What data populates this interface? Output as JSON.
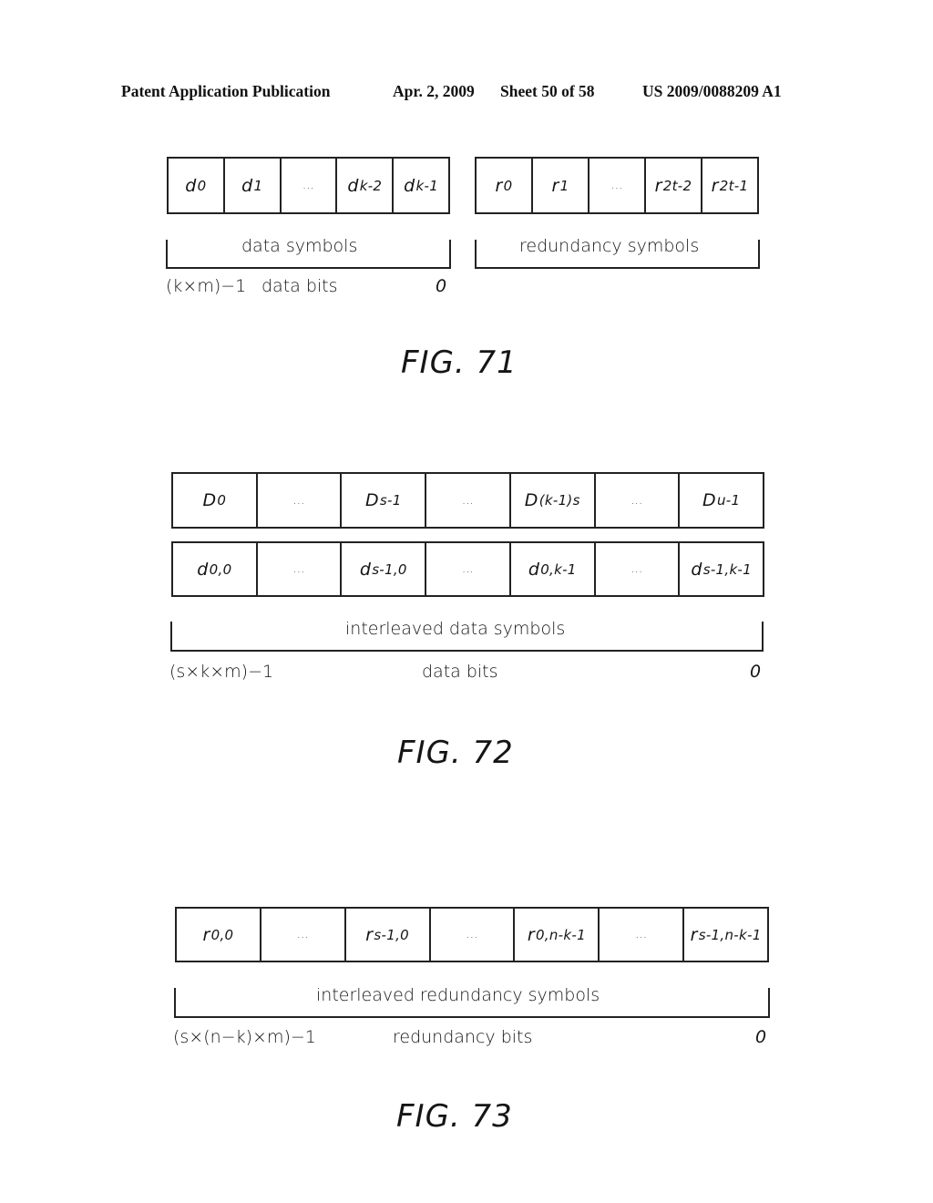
{
  "header": {
    "left": "Patent Application Publication",
    "date": "Apr. 2, 2009",
    "sheet": "Sheet 50 of 58",
    "patent_number": "US 2009/0088209 A1"
  },
  "fig71": {
    "data_cells": [
      {
        "base": "d",
        "sub": "0"
      },
      {
        "base": "d",
        "sub": "1"
      },
      {
        "base": "...",
        "sub": ""
      },
      {
        "base": "d",
        "sub": "k-2"
      },
      {
        "base": "d",
        "sub": "k-1"
      }
    ],
    "redundancy_cells": [
      {
        "base": "r",
        "sub": "0"
      },
      {
        "base": "r",
        "sub": "1"
      },
      {
        "base": "...",
        "sub": ""
      },
      {
        "base": "r",
        "sub": "2t-2"
      },
      {
        "base": "r",
        "sub": "2t-1"
      }
    ],
    "data_brace_label": "data symbols",
    "redundancy_brace_label": "redundancy symbols",
    "bits_high": "(k×m)−1",
    "bits_label": "data bits",
    "bits_low": "0",
    "caption": "FIG. 71"
  },
  "fig72": {
    "top_cells": [
      {
        "base": "D",
        "sub": "0"
      },
      {
        "base": "...",
        "sub": ""
      },
      {
        "base": "D",
        "sub": "s-1"
      },
      {
        "base": "...",
        "sub": ""
      },
      {
        "base": "D",
        "sub": "(k-1)s"
      },
      {
        "base": "...",
        "sub": ""
      },
      {
        "base": "D",
        "sub": "u-1"
      }
    ],
    "bottom_cells": [
      {
        "base": "d",
        "sub": "0,0"
      },
      {
        "base": "...",
        "sub": ""
      },
      {
        "base": "d",
        "sub": "s-1,0"
      },
      {
        "base": "...",
        "sub": ""
      },
      {
        "base": "d",
        "sub": "0,k-1"
      },
      {
        "base": "...",
        "sub": ""
      },
      {
        "base": "d",
        "sub": "s-1,k-1"
      }
    ],
    "brace_label": "interleaved data symbols",
    "bits_high": "(s×k×m)−1",
    "bits_label": "data bits",
    "bits_low": "0",
    "caption": "FIG. 72"
  },
  "fig73": {
    "cells": [
      {
        "base": "r",
        "sub": "0,0"
      },
      {
        "base": "...",
        "sub": ""
      },
      {
        "base": "r",
        "sub": "s-1,0"
      },
      {
        "base": "...",
        "sub": ""
      },
      {
        "base": "r",
        "sub": "0,n-k-1"
      },
      {
        "base": "...",
        "sub": ""
      },
      {
        "base": "r",
        "sub": "s-1,n-k-1"
      }
    ],
    "brace_label": "interleaved redundancy symbols",
    "bits_high": "(s×(n−k)×m)−1",
    "bits_label": "redundancy bits",
    "bits_low": "0",
    "caption": "FIG. 73"
  }
}
